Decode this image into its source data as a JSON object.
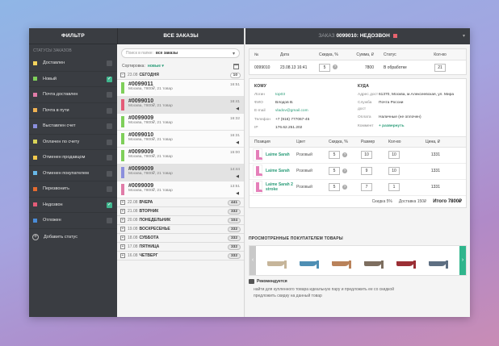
{
  "filter": {
    "title": "ФИЛЬТР",
    "subtitle": "СТАТУСЫ ЗАКАЗОВ",
    "statuses": [
      {
        "label": "Доставлен",
        "color": "#f3d35c",
        "checked": false
      },
      {
        "label": "Новый",
        "color": "#7fcf5a",
        "checked": true
      },
      {
        "label": "Почта доставлен",
        "color": "#e07ca8",
        "checked": false
      },
      {
        "label": "Почта в пути",
        "color": "#f0b253",
        "checked": false
      },
      {
        "label": "Выставлен счет",
        "color": "#8b8fdc",
        "checked": false
      },
      {
        "label": "Оплачен по счету",
        "color": "#d8d357",
        "checked": false
      },
      {
        "label": "Отменен продавцом",
        "color": "#f2c94c",
        "checked": false
      },
      {
        "label": "Отменен покупателем",
        "color": "#68b8e8",
        "checked": false
      },
      {
        "label": "Перезвонить",
        "color": "#e46b2f",
        "checked": false
      },
      {
        "label": "Недозвон",
        "color": "#e45c78",
        "checked": true
      },
      {
        "label": "Отложен",
        "color": "#4a8cd8",
        "checked": false
      }
    ],
    "add_status": "Добавить статус"
  },
  "orders": {
    "title": "ВСЕ ЗАКАЗЫ",
    "search_placeholder": "Поиск в папке:",
    "search_value": "все заказы",
    "sort_label": "Сортировка:",
    "sort_value": "новые",
    "today": {
      "date": "23.08",
      "day": "СЕГОДНЯ",
      "count": "10"
    },
    "items": [
      {
        "num": "#0099011",
        "info": "Москва, 7800₽, 21 товар",
        "time": "16:51",
        "icon": "",
        "color": "#7fcf5a",
        "selected": false
      },
      {
        "num": "#0099010",
        "info": "Москва, 7800₽, 21 товар",
        "time": "16:41",
        "icon": "◀",
        "color": "#e45c78",
        "selected": true
      },
      {
        "num": "#0099009",
        "info": "Москва, 7800₽, 21 товар",
        "time": "16:32",
        "icon": "",
        "color": "#7fcf5a",
        "selected": false
      },
      {
        "num": "#0099010",
        "info": "Москва, 7800₽, 21 товар",
        "time": "16:31",
        "icon": "◀",
        "color": "#7fcf5a",
        "selected": false
      },
      {
        "num": "#0099009",
        "info": "Москва, 7800₽, 21 товар",
        "time": "15:00",
        "icon": "",
        "color": "#7fcf5a",
        "selected": false
      },
      {
        "num": "#0099009",
        "info": "Москва, 7800₽, 21 товар",
        "time": "14:44",
        "icon": "◀",
        "color": "#8b8fdc",
        "selected": true
      },
      {
        "num": "#0099009",
        "info": "Москва, 7800₽, 21 товар",
        "time": "13:51",
        "icon": "◀",
        "color": "#e07ca8",
        "selected": false
      }
    ],
    "groups": [
      {
        "date": "22.08",
        "day": "ВЧЕРА",
        "count": "441"
      },
      {
        "date": "21.08",
        "day": "ВТОРНИК",
        "count": "332"
      },
      {
        "date": "20.08",
        "day": "ПОНЕДЕЛЬНИК",
        "count": "104"
      },
      {
        "date": "19.08",
        "day": "ВОСКРЕСЕНЬЕ",
        "count": "332"
      },
      {
        "date": "18.08",
        "day": "СУББОТА",
        "count": "332"
      },
      {
        "date": "17.08",
        "day": "ПЯТНИЦА",
        "count": "332"
      },
      {
        "date": "16.08",
        "day": "ЧЕТВЕРГ",
        "count": "332"
      }
    ]
  },
  "detail": {
    "title_prefix": "ЗАКАЗ",
    "title_num": "0099010: НЕДОЗВОН",
    "summary": {
      "headers": [
        "№",
        "Дата",
        "Скидка, %",
        "Сумма, ₽",
        "Статус",
        "Кол-во"
      ],
      "values": [
        "0099010",
        "23.08.13 16:41",
        "5",
        "7800",
        "В обработке",
        "21"
      ]
    },
    "to": {
      "title": "КОМУ",
      "rows": [
        {
          "k": "Логин",
          "v": "top03"
        },
        {
          "k": "ФИО",
          "v": "Влодов В."
        },
        {
          "k": "E-mail",
          "v": "vladov@gmail.com"
        },
        {
          "k": "Телефон",
          "v": "+7 (916) 777067-45"
        },
        {
          "k": "IP",
          "v": "176.62.251.202"
        }
      ]
    },
    "from": {
      "title": "КУДА",
      "rows": [
        {
          "k": "Адрес дост",
          "v": "61370, Москва, м.Алексеевская, ул. Мира"
        },
        {
          "k": "Служба дост",
          "v": "Почта России"
        },
        {
          "k": "Оплата",
          "v": "Наличные (не оплочен)"
        },
        {
          "k": "Коммент",
          "v": "+ развернуть"
        }
      ]
    },
    "positions": {
      "headers": [
        "Позиция",
        "Цвет",
        "Скидка, %",
        "Размер",
        "Кол-во",
        "Цена, ₽"
      ],
      "rows": [
        {
          "name": "Laime Sarah",
          "color": "Розовый",
          "discount": "5",
          "size": "10",
          "qty": "10",
          "price": "1331"
        },
        {
          "name": "Laime Sarah",
          "color": "Розовый",
          "discount": "5",
          "size": "9",
          "qty": "10",
          "price": "1331"
        },
        {
          "name": "Laime Sarah 2 stroke",
          "color": "Розовый",
          "discount": "5",
          "size": "7",
          "qty": "1",
          "price": "1331"
        }
      ]
    },
    "totals": {
      "discount": "Скидка 5%",
      "delivery": "Доставка 150₽",
      "total": "Итого 7800₽"
    },
    "viewed_title": "ПРОСМОТРЕННЫЕ ПОКУПАТЕЛЕМ ТОВАРЫ",
    "viewed_items": [
      {
        "color": "#c6b59a"
      },
      {
        "color": "#4f8fb4"
      },
      {
        "color": "#b9825a"
      },
      {
        "color": "#7d6e5f"
      },
      {
        "color": "#9b2f35"
      },
      {
        "color": "#5e6f82"
      }
    ],
    "recommend_title": "Рекомендуется",
    "recommend_lines": [
      "найти для купленного товара идеальную пару и предложить ее со скидкой",
      "предложить скидку на данный товар"
    ]
  }
}
